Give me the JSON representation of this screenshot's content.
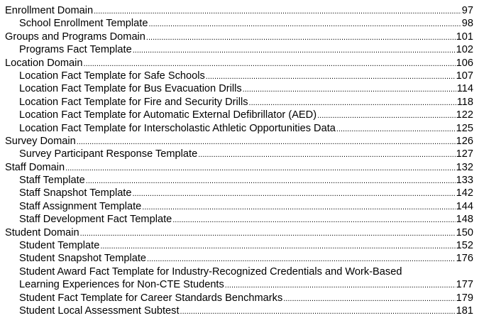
{
  "toc": [
    {
      "level": 1,
      "title": "Enrollment Domain",
      "page": "97"
    },
    {
      "level": 2,
      "title": "School Enrollment Template",
      "page": "98"
    },
    {
      "level": 1,
      "title": "Groups and Programs Domain",
      "page": "101"
    },
    {
      "level": 2,
      "title": "Programs Fact Template",
      "page": "102"
    },
    {
      "level": 1,
      "title": "Location Domain",
      "page": "106"
    },
    {
      "level": 2,
      "title": "Location Fact Template for Safe Schools",
      "page": "107"
    },
    {
      "level": 2,
      "title": "Location Fact Template for Bus Evacuation Drills",
      "page": "114"
    },
    {
      "level": 2,
      "title": "Location Fact Template for Fire and Security Drills",
      "page": "118"
    },
    {
      "level": 2,
      "title": "Location Fact Template for Automatic External Defibrillator (AED)",
      "page": "122"
    },
    {
      "level": 2,
      "title": "Location Fact Template for Interscholastic Athletic Opportunities Data",
      "page": "125"
    },
    {
      "level": 1,
      "title": "Survey Domain",
      "page": "126"
    },
    {
      "level": 2,
      "title": "Survey Participant Response Template",
      "page": "127"
    },
    {
      "level": 1,
      "title": "Staff Domain",
      "page": "132"
    },
    {
      "level": 2,
      "title": "Staff Template",
      "page": "133"
    },
    {
      "level": 2,
      "title": "Staff Snapshot Template",
      "page": "142"
    },
    {
      "level": 2,
      "title": "Staff Assignment Template",
      "page": "144"
    },
    {
      "level": 2,
      "title": "Staff Development Fact Template",
      "page": "148"
    },
    {
      "level": 1,
      "title": "Student Domain",
      "page": "150"
    },
    {
      "level": 2,
      "title": "Student Template",
      "page": "152"
    },
    {
      "level": 2,
      "title": "Student Snapshot Template",
      "page": "176"
    },
    {
      "level": 2,
      "title_line1": "Student Award Fact Template for Industry-Recognized Credentials and Work-Based",
      "title_line2": "Learning Experiences for Non-CTE Students",
      "page": "177"
    },
    {
      "level": 2,
      "title": "Student Fact Template for Career Standards Benchmarks",
      "page": "179"
    },
    {
      "level": 2,
      "title": "Student Local Assessment Subtest",
      "page": "181"
    }
  ]
}
